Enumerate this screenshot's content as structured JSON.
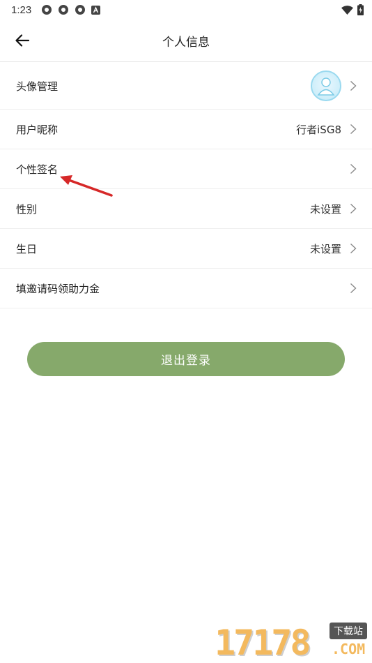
{
  "status_bar": {
    "time": "1:23"
  },
  "header": {
    "title": "个人信息"
  },
  "rows": [
    {
      "label": "头像管理",
      "value": ""
    },
    {
      "label": "用户昵称",
      "value": "行者iSG8"
    },
    {
      "label": "个性签名",
      "value": ""
    },
    {
      "label": "性别",
      "value": "未设置"
    },
    {
      "label": "生日",
      "value": "未设置"
    },
    {
      "label": "填邀请码领助力金",
      "value": ""
    }
  ],
  "logout": {
    "label": "退出登录"
  },
  "watermark": {
    "digits": "17178",
    "tag": "下载站",
    "suffix": ".COM"
  },
  "colors": {
    "accent": "#86a96b",
    "annotation_arrow": "#d62828"
  }
}
